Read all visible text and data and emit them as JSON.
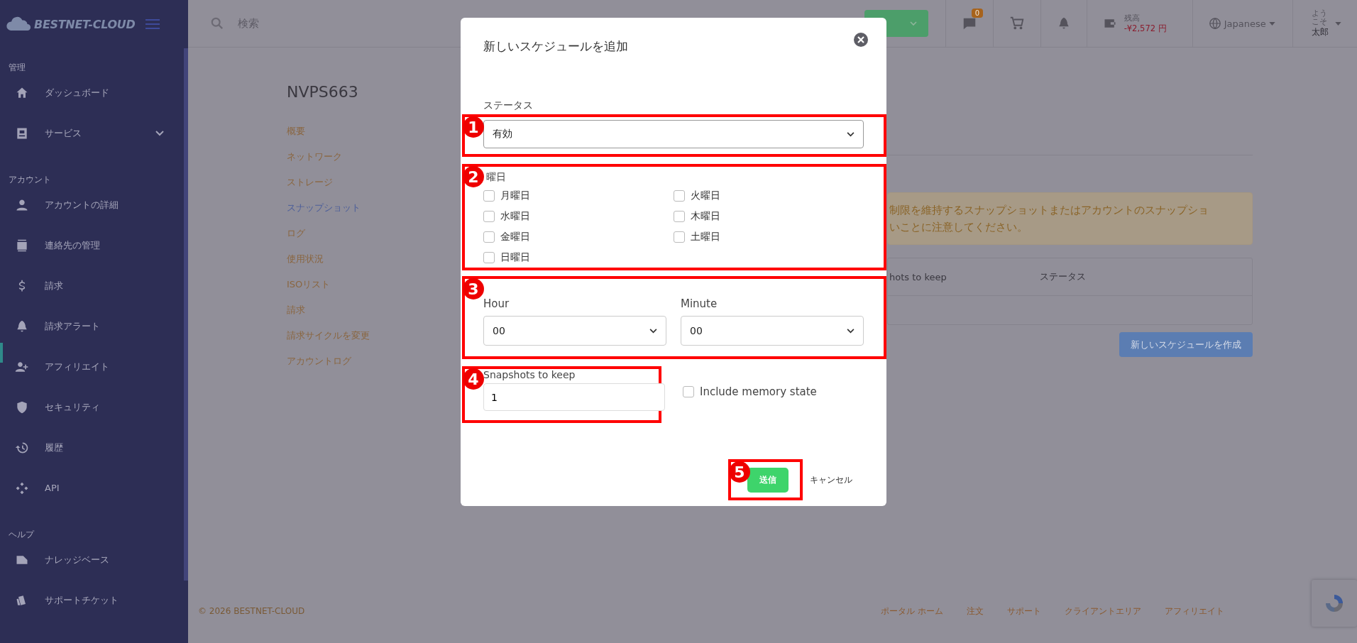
{
  "sidebar": {
    "logo": "BESTNET-CLOUD",
    "sections": [
      {
        "title": "管理",
        "items": [
          {
            "label": "ダッシュボード",
            "expandable": false
          },
          {
            "label": "サービス",
            "expandable": true
          }
        ]
      },
      {
        "title": "アカウント",
        "items": [
          {
            "label": "アカウントの詳細",
            "expandable": false
          },
          {
            "label": "連絡先の管理",
            "expandable": false
          },
          {
            "label": "請求",
            "expandable": false
          },
          {
            "label": "請求アラート",
            "expandable": false
          },
          {
            "label": "アフィリエイト",
            "expandable": false
          },
          {
            "label": "セキュリティ",
            "expandable": false
          },
          {
            "label": "履歴",
            "expandable": false
          },
          {
            "label": "API",
            "expandable": false
          }
        ]
      },
      {
        "title": "ヘルプ",
        "items": [
          {
            "label": "ナレッジベース",
            "expandable": false
          },
          {
            "label": "サポートチケット",
            "expandable": false
          }
        ]
      }
    ]
  },
  "topbar": {
    "search": {
      "placeholder": "検索"
    },
    "messages_badge": "0",
    "balance": {
      "label": "残高",
      "amount": "-¥2,572 円"
    },
    "language": "Japanese",
    "user": {
      "greeting": "ようこそ",
      "name": "太郎"
    }
  },
  "page": {
    "title": "NVPS663",
    "subnav": [
      {
        "label": "概要",
        "selected": false
      },
      {
        "label": "ネットワーク",
        "selected": false
      },
      {
        "label": "ストレージ",
        "selected": false
      },
      {
        "label": "スナップショット",
        "selected": true
      },
      {
        "label": "ログ",
        "selected": false
      },
      {
        "label": "使用状況",
        "selected": false
      },
      {
        "label": "ISOリスト",
        "selected": false
      },
      {
        "label": "請求",
        "selected": false
      },
      {
        "label": "請求サイクルを変更",
        "selected": false
      },
      {
        "label": "アカウントログ",
        "selected": false
      }
    ],
    "notice": [
      "制限を維持するスナップショットまたはアカウントのスナップショ",
      "いことに注意してください。"
    ],
    "table": {
      "columns": [
        "hots to keep",
        "ステータス"
      ]
    },
    "create_button": "新しいスケジュールを作成"
  },
  "footer": {
    "copyright": "© 2026 BESTNET-CLOUD",
    "links": [
      "ポータル ホーム",
      "注文",
      "サポート",
      "クライアントエリア",
      "アフィリエイト"
    ]
  },
  "modal": {
    "title": "新しいスケジュールを追加",
    "status": {
      "label": "ステータス",
      "value": "有効"
    },
    "days": {
      "label": "曜日",
      "items": [
        {
          "label": "月曜日",
          "checked": false
        },
        {
          "label": "火曜日",
          "checked": false
        },
        {
          "label": "水曜日",
          "checked": false
        },
        {
          "label": "木曜日",
          "checked": false
        },
        {
          "label": "金曜日",
          "checked": false
        },
        {
          "label": "土曜日",
          "checked": false
        },
        {
          "label": "日曜日",
          "checked": false
        }
      ]
    },
    "hour": {
      "label": "Hour",
      "value": "00"
    },
    "minute": {
      "label": "Minute",
      "value": "00"
    },
    "snapshots": {
      "label": "Snapshots to keep",
      "value": "1"
    },
    "include_memory": {
      "label": "Include memory state",
      "checked": false
    },
    "submit": "送信",
    "cancel": "キャンセル"
  },
  "annotations": [
    {
      "label": "1"
    },
    {
      "label": "2"
    },
    {
      "label": "3"
    },
    {
      "label": "4"
    },
    {
      "label": "5"
    }
  ]
}
